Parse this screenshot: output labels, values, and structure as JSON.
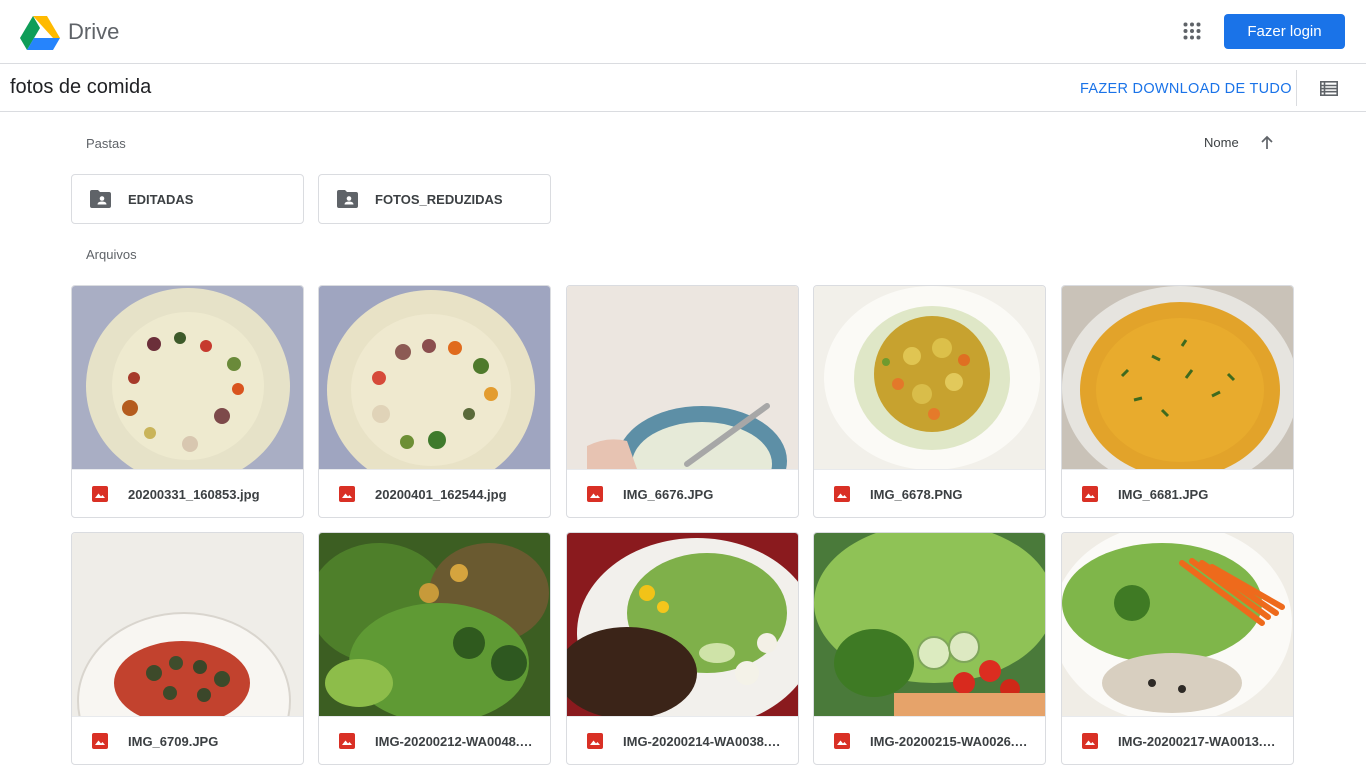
{
  "header": {
    "app_name": "Drive",
    "login_label": "Fazer login",
    "logo_icon": "google-drive-logo",
    "apps_icon": "apps-grid-icon",
    "accent_color": "#1a73e8"
  },
  "subheader": {
    "folder_title": "fotos de comida",
    "download_all_label": "FAZER DOWNLOAD DE TUDO",
    "view_icon": "list-view-icon"
  },
  "sections": {
    "folders_label": "Pastas",
    "files_label": "Arquivos",
    "sort_label": "Nome",
    "sort_icon": "arrow-up-icon"
  },
  "folders": [
    {
      "name": "EDITADAS",
      "icon": "shared-folder-icon"
    },
    {
      "name": "FOTOS_REDUZIDAS",
      "icon": "shared-folder-icon"
    }
  ],
  "files": [
    {
      "name": "20200331_160853.jpg",
      "icon": "image-file-icon"
    },
    {
      "name": "20200401_162544.jpg",
      "icon": "image-file-icon"
    },
    {
      "name": "IMG_6676.JPG",
      "icon": "image-file-icon"
    },
    {
      "name": "IMG_6678.PNG",
      "icon": "image-file-icon"
    },
    {
      "name": "IMG_6681.JPG",
      "icon": "image-file-icon"
    },
    {
      "name": "IMG_6709.JPG",
      "icon": "image-file-icon"
    },
    {
      "name": "IMG-20200212-WA0048.j…",
      "icon": "image-file-icon"
    },
    {
      "name": "IMG-20200214-WA0038.j…",
      "icon": "image-file-icon"
    },
    {
      "name": "IMG-20200215-WA0026.jpg",
      "icon": "image-file-icon"
    },
    {
      "name": "IMG-20200217-WA0013.j…",
      "icon": "image-file-icon"
    }
  ]
}
